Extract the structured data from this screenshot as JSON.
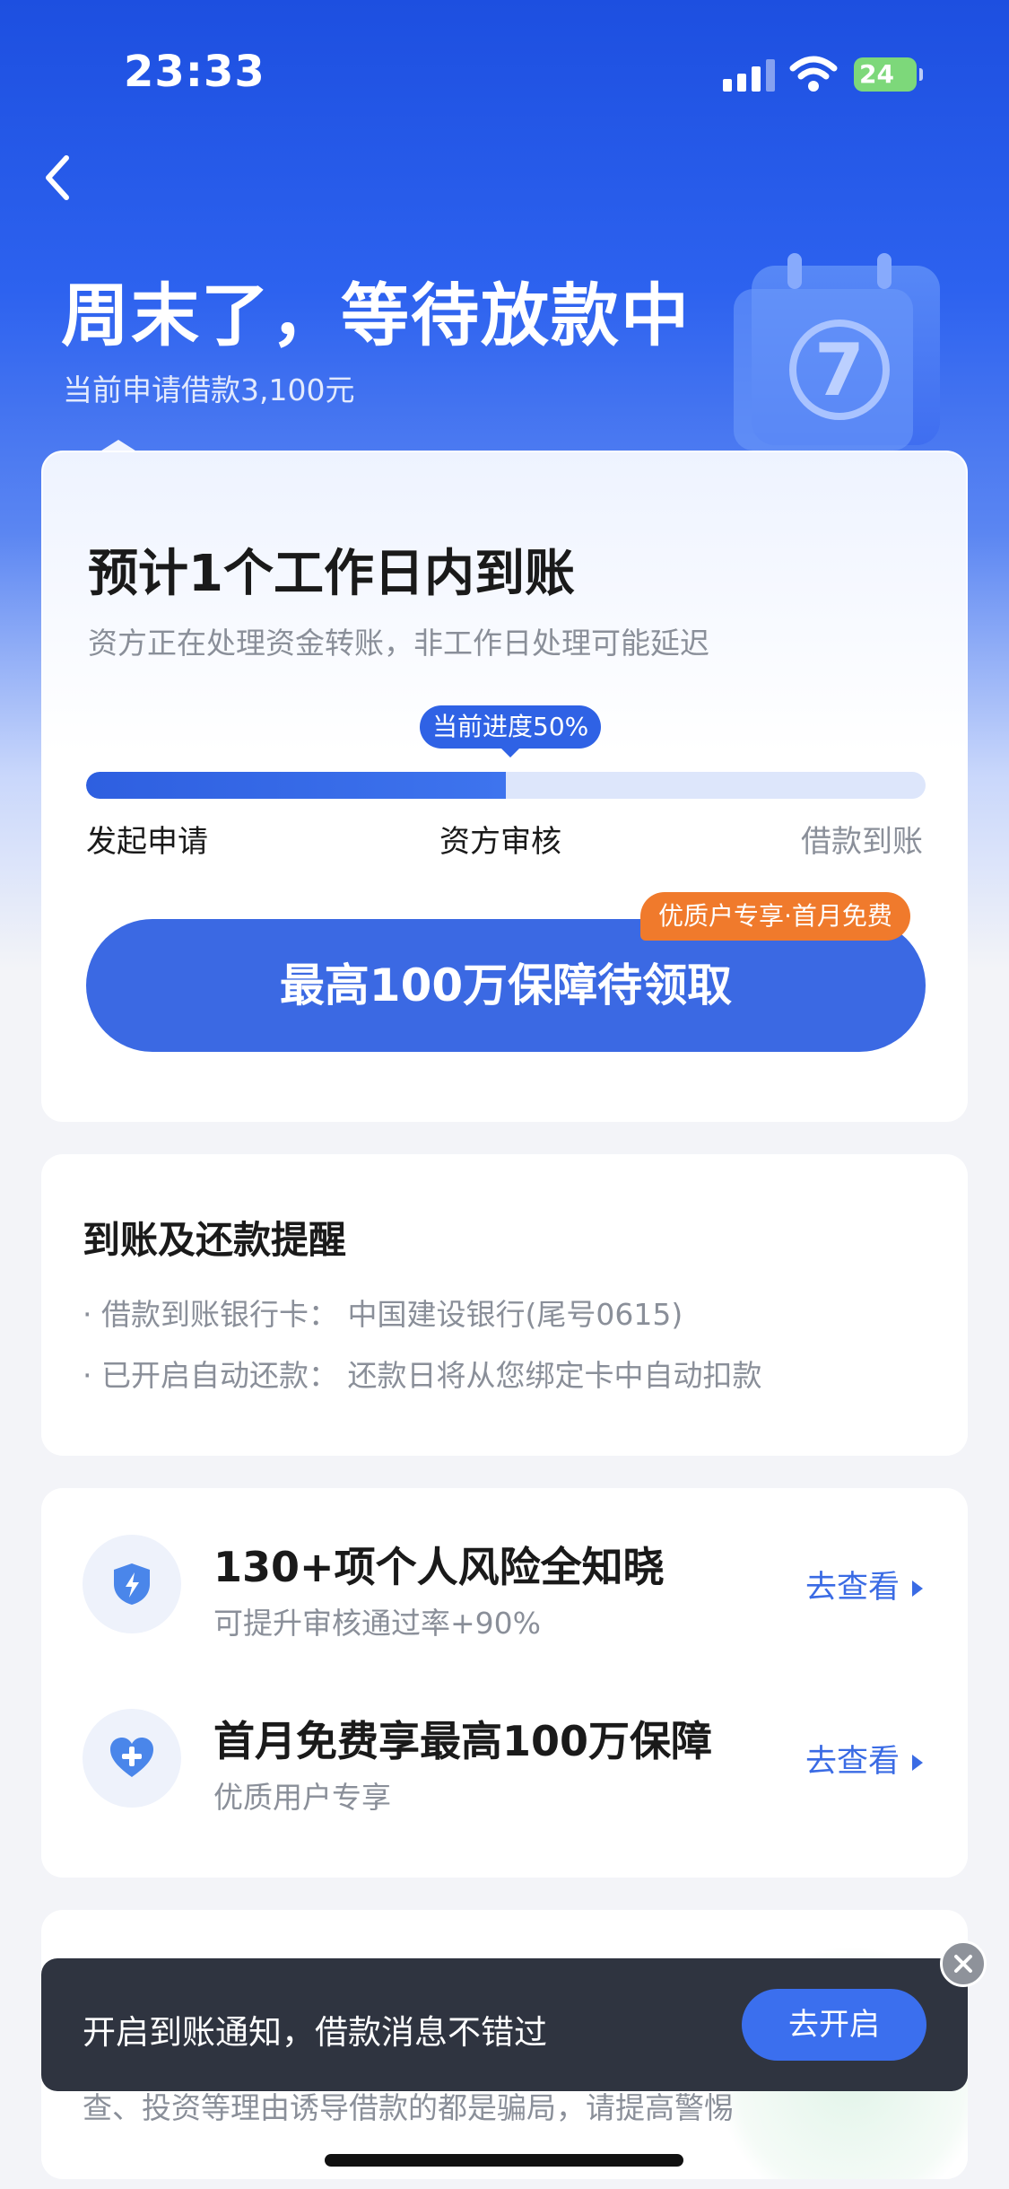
{
  "status_bar": {
    "time": "23:33",
    "battery": "24"
  },
  "hero": {
    "title": "周末了，等待放款中",
    "subtitle": "当前申请借款3,100元",
    "calendar_day": "7"
  },
  "main_card": {
    "eta_title": "预计1个工作日内到账",
    "eta_desc": "资方正在处理资金转账，非工作日处理可能延迟",
    "progress_label": "当前进度50%",
    "progress_value": 0.5,
    "steps": [
      "发起申请",
      "资方审核",
      "借款到账"
    ],
    "cta_label": "最高100万保障待领取",
    "cta_tag": "优质户专享·首月免费"
  },
  "remind_card": {
    "title": "到账及还款提醒",
    "lines": [
      "· 借款到账银行卡：  中国建设银行(尾号0615)",
      "· 已开启自动还款：  还款日将从您绑定卡中自动扣款"
    ]
  },
  "services": [
    {
      "icon": "shield-icon",
      "title": "130+项个人风险全知晓",
      "subtitle": "可提升审核通过率+90%",
      "link": "去查看"
    },
    {
      "icon": "heart-plus-icon",
      "title": "首月免费享最高100万保障",
      "subtitle": "优质用户专享",
      "link": "去查看"
    }
  ],
  "tip_card": {
    "text": "查、投资等理由诱导借款的都是骗局，请提高警惕"
  },
  "toast": {
    "text": "开启到账通知，借款消息不错过",
    "button": "去开启"
  },
  "colors": {
    "primary": "#3b69e3",
    "accent_orange": "#f07a2c",
    "toast_bg": "#2f3440"
  }
}
